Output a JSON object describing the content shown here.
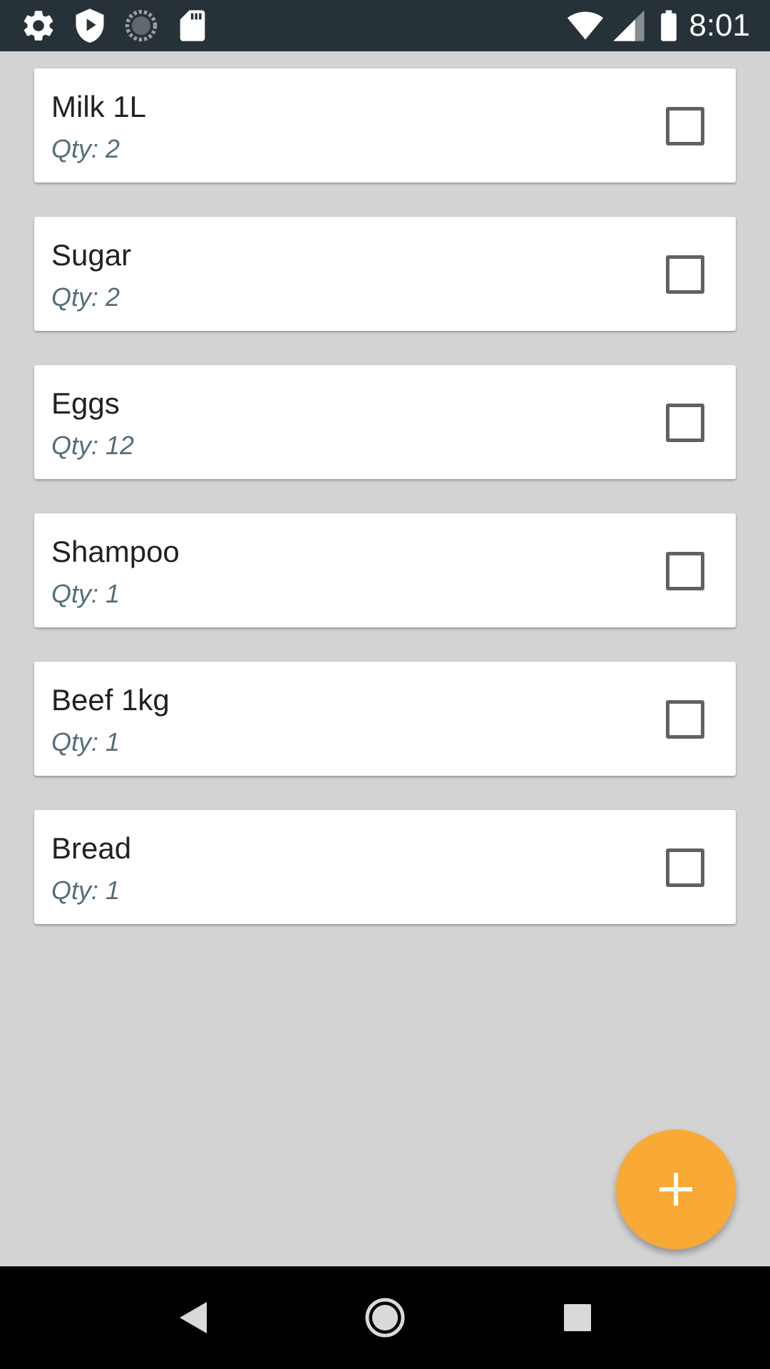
{
  "status_bar": {
    "time": "8:01",
    "left_icons": [
      "settings-icon",
      "shield-play-icon",
      "sync-spinner-icon",
      "sd-card-icon"
    ],
    "right_icons": [
      "wifi-icon",
      "cellular-signal-icon",
      "battery-icon"
    ]
  },
  "items": [
    {
      "name": "Milk 1L",
      "qty": "Qty: 2",
      "checked": false
    },
    {
      "name": "Sugar",
      "qty": "Qty: 2",
      "checked": false
    },
    {
      "name": "Eggs",
      "qty": "Qty: 12",
      "checked": false
    },
    {
      "name": "Shampoo",
      "qty": "Qty: 1",
      "checked": false
    },
    {
      "name": "Beef 1kg",
      "qty": "Qty: 1",
      "checked": false
    },
    {
      "name": "Bread",
      "qty": "Qty: 1",
      "checked": false
    }
  ],
  "fab": {
    "icon": "plus-icon",
    "color": "#f9a935"
  },
  "nav_bar": {
    "buttons": [
      "back-icon",
      "home-icon",
      "recents-icon"
    ]
  },
  "colors": {
    "status_bar": "#263238",
    "background": "#d3d3d3",
    "qty_text": "#546e7a",
    "accent": "#f9a935"
  }
}
